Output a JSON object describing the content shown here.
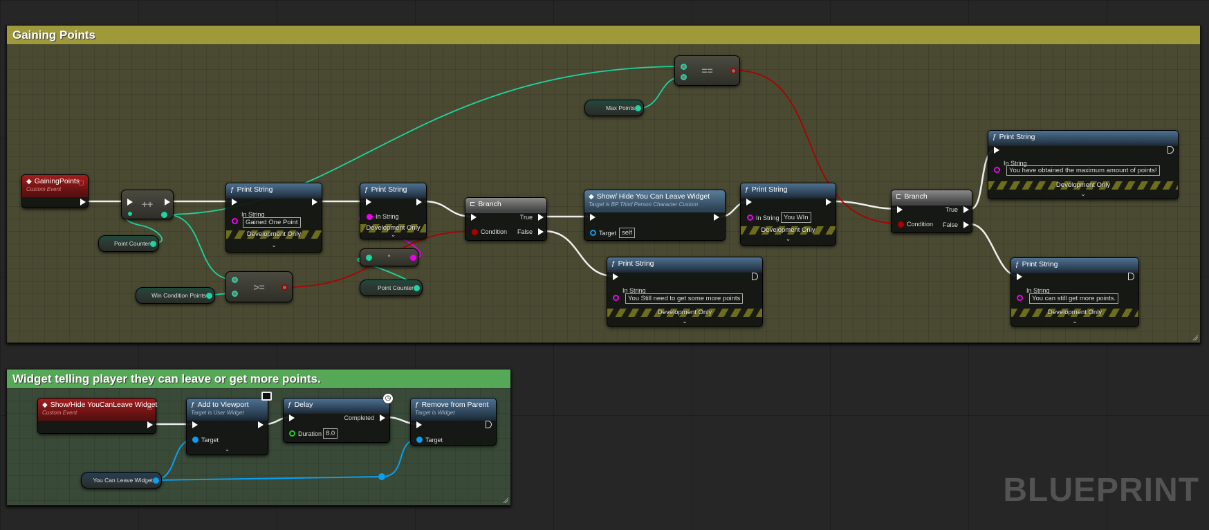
{
  "comments": [
    {
      "title": "Gaining Points",
      "color": "#9e9a3a"
    },
    {
      "title": "Widget telling player they can leave or get more points.",
      "color": "#55a855"
    }
  ],
  "watermark": "BLUEPRINT",
  "labels": {
    "custom_event": "Custom Event",
    "in_string": "In String",
    "dev_only": "Development Only",
    "target": "Target",
    "condition": "Condition",
    "true": "True",
    "false": "False",
    "completed": "Completed",
    "duration": "Duration"
  },
  "nodes": {
    "gaining_points": {
      "title": "GainingPoints"
    },
    "increment": {
      "op": "++"
    },
    "point_counter_1": {
      "label": "Point Counter"
    },
    "win_condition": {
      "label": "Win Condition Points"
    },
    "gte": {
      "op": ">="
    },
    "print1": {
      "title": "Print String",
      "value": "Gained One Point"
    },
    "print2": {
      "title": "Print String"
    },
    "conv": {
      "op": "•"
    },
    "point_counter_2": {
      "label": "Point Counter"
    },
    "branch1": {
      "title": "Branch"
    },
    "show_hide_call": {
      "title": "Show/ Hide You Can Leave Widget",
      "subtitle": "Target is BP Third Person Character Custom",
      "target": "self"
    },
    "print_win": {
      "title": "Print String",
      "value": "You WIn"
    },
    "print_still": {
      "title": "Print String",
      "value": "You Still need to get some more points"
    },
    "eq": {
      "op": "=="
    },
    "max_points": {
      "label": "Max Points"
    },
    "branch2": {
      "title": "Branch"
    },
    "print_max": {
      "title": "Print String",
      "value": "You have obtained the maximum amount of points!"
    },
    "print_more": {
      "title": "Print String",
      "value": "You can still get more points."
    },
    "show_hide_event": {
      "title": "Show/Hide YouCanLeave Widget"
    },
    "add_viewport": {
      "title": "Add to Viewport",
      "subtitle": "Target is User Widget"
    },
    "delay": {
      "title": "Delay",
      "duration": "8.0"
    },
    "remove_parent": {
      "title": "Remove from Parent",
      "subtitle": "Target is Widget"
    },
    "you_can_leave": {
      "label": "You Can Leave Widget"
    }
  },
  "colors": {
    "exec": "#ffffff",
    "int": "#1ed4a0",
    "bool": "#a00000",
    "string": "#e000e0",
    "object": "#0aa0f0",
    "float": "#22cc22"
  }
}
